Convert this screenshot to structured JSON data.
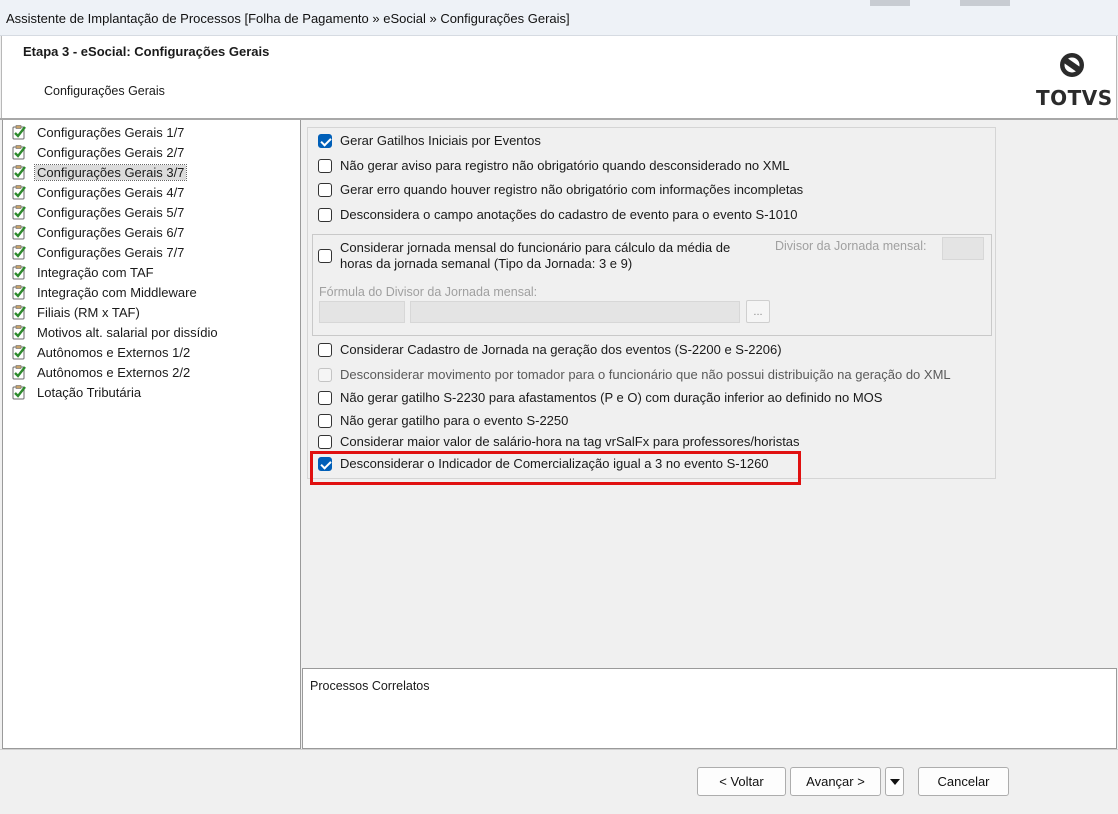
{
  "window": {
    "title": "Assistente de Implantação de Processos [Folha de Pagamento » eSocial » Configurações Gerais]"
  },
  "header": {
    "step_title": "Etapa 3 - eSocial: Configurações Gerais",
    "subtitle": "Configurações Gerais",
    "logo_text": "TOTVS"
  },
  "tree": {
    "selected_index": 2,
    "items": [
      {
        "label": "Configurações Gerais 1/7"
      },
      {
        "label": "Configurações Gerais 2/7"
      },
      {
        "label": "Configurações Gerais 3/7"
      },
      {
        "label": "Configurações Gerais 4/7"
      },
      {
        "label": "Configurações Gerais 5/7"
      },
      {
        "label": "Configurações Gerais 6/7"
      },
      {
        "label": "Configurações Gerais 7/7"
      },
      {
        "label": "Integração com TAF"
      },
      {
        "label": "Integração com Middleware"
      },
      {
        "label": "Filiais (RM x TAF)"
      },
      {
        "label": "Motivos alt. salarial por dissídio"
      },
      {
        "label": "Autônomos e Externos 1/2"
      },
      {
        "label": "Autônomos e Externos 2/2"
      },
      {
        "label": "Lotação Tributária"
      }
    ]
  },
  "options": {
    "gatilhos_iniciais": {
      "label": "Gerar Gatilhos Iniciais por Eventos",
      "checked": true
    },
    "nao_gerar_aviso": {
      "label": "Não gerar aviso para registro não obrigatório quando desconsiderado no XML",
      "checked": false
    },
    "gerar_erro": {
      "label": "Gerar erro quando houver registro não obrigatório com informações incompletas",
      "checked": false
    },
    "desconsidera_anotacoes": {
      "label": "Desconsidera o campo anotações do cadastro de evento para o evento S-1010",
      "checked": false
    },
    "jornada_mensal": {
      "label_line1": "Considerar jornada mensal do funcionário para cálculo da média de",
      "label_line2": "horas da jornada semanal (Tipo da Jornada: 3 e 9)",
      "checked": false
    },
    "divisor_label": "Divisor da Jornada mensal:",
    "formula_label": "Fórmula do Divisor da Jornada mensal:",
    "formula_button": "...",
    "cadastro_jornada": {
      "label": "Considerar Cadastro de Jornada na geração dos eventos (S-2200 e S-2206)",
      "checked": false
    },
    "desconsiderar_tomador": {
      "label": "Desconsiderar movimento por tomador para o funcionário que não possui distribuição na geração do XML",
      "checked": false,
      "disabled": true
    },
    "nao_gerar_s2230": {
      "label": "Não gerar gatilho S-2230 para afastamentos (P e O) com duração inferior ao definido no MOS",
      "checked": false
    },
    "nao_gerar_s2250": {
      "label": "Não gerar gatilho para o evento S-2250",
      "checked": false
    },
    "maior_salario_hora": {
      "label": "Considerar maior valor de salário-hora na tag vrSalFx para professores/horistas",
      "checked": false
    },
    "indicador_comercializacao": {
      "label": "Desconsiderar o Indicador de Comercialização igual a 3 no evento S-1260",
      "checked": true,
      "highlighted": true
    }
  },
  "related": {
    "label": "Processos Correlatos"
  },
  "footer": {
    "back": "< Voltar",
    "next": "Avançar >",
    "cancel": "Cancelar"
  },
  "colors": {
    "checkbox_accent": "#005fb8",
    "highlight": "#e01010",
    "tree_check": "#2e8b2e"
  }
}
